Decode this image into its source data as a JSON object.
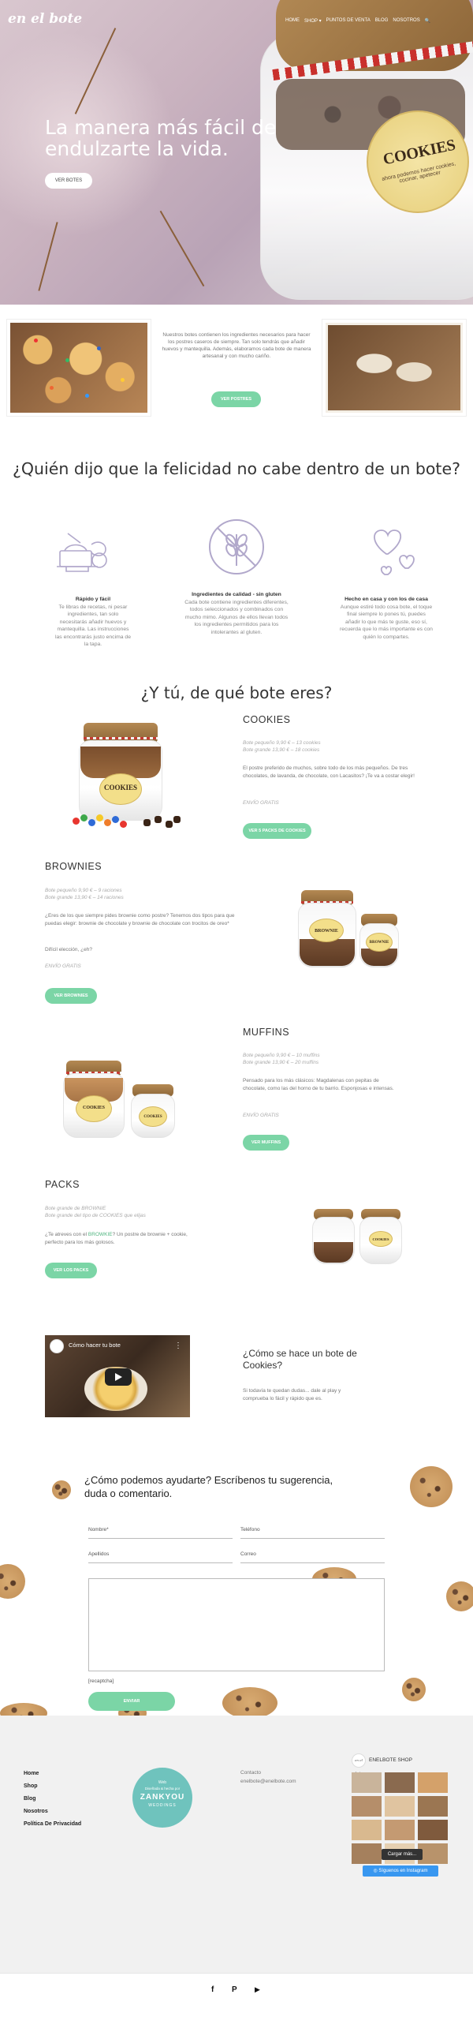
{
  "header": {
    "logo": "en el bote",
    "nav": [
      "HOME",
      "SHOP ▾",
      "PUNTOS DE VENTA",
      "BLOG",
      "NOSOTROS",
      "🔍"
    ]
  },
  "hero": {
    "title": "La manera más fácil de endulzarte la vida.",
    "button": "VER BOTES",
    "jar_label": "COOKIES",
    "jar_sublabel": "ahora podemos hacer cookies, cocinar, apetecer"
  },
  "intro": {
    "text": "Nuestros botes contienen los ingredientes necesarios para hacer los postres caseros de siempre. Tan solo tendrás que añadir huevos y mantequilla. Además, elaboramos cada bote de manera artesanal y con mucho cariño.",
    "button": "VER POSTRES"
  },
  "headline": "¿Quién dijo que la felicidad no cabe dentro de un bote?",
  "features": [
    {
      "title": "Rápido y fácil",
      "text": "Te libras de recetas, ni pesar ingredientes, tan solo necesitarás añadir huevos y mantequilla. Las instrucciones las encontrarás justo encima de la tapa."
    },
    {
      "title": "Ingredientes de calidad - sin gluten",
      "text": "Cada bote contiene ingredientes diferentes, todos seleccionados y combinados con mucho mimo. Algunos de ellos llevan todos los ingredientes permitidos para los intolerantes al gluten."
    },
    {
      "title": "Hecho en casa y con los de casa",
      "text": "Aunque estiré todo cosa bote, el toque final siempre lo pones tú, puedes añadir lo que más te guste, eso sí, recuerda que lo más importante es con quién lo compartes."
    }
  ],
  "products_title": "¿Y tú, de qué bote eres?",
  "products": {
    "cookies": {
      "title": "COOKIES",
      "price_small": "Bote pequeño 9,90 € – 13 cookies",
      "price_big": "Bote grande 13,90 € – 18 cookies",
      "desc": "El postre preferido de muchos, sobre todo de los más pequeños. De tres chocolates, de lavanda, de chocolate, con Lacasitos? ¡Te va a costar elegir!",
      "shipping": "ENVÍO GRATIS",
      "button": "VER 5 PACKS DE COOKIES",
      "label": "COOKIES"
    },
    "brownies": {
      "title": "BROWNIES",
      "price_small": "Bote pequeño 9,90 € – 9 raciones",
      "price_big": "Bote grande 13,90 € – 14 raciones",
      "desc": "¿Eres de los que siempre pides brownie como postre? Tenemos dos tipos para que puedas elegir: brownie de chocolate y brownie de chocolate con trocitos de oreo*",
      "desc2": "Difícil elección, ¿eh?",
      "shipping": "ENVÍO GRATIS",
      "button": "VER BROWNIES",
      "label": "BROWNIE"
    },
    "muffins": {
      "title": "MUFFINS",
      "price_small": "Bote pequeño 9,90 € – 10 muffins",
      "price_big": "Bote grande 13,90 € – 20 muffins",
      "desc": "Pensado para los más clásicos: Magdalenas con pepitas de chocolate, como las del horno de tu barrio. Esponjosas e intensas.",
      "shipping": "ENVÍO GRATIS",
      "button": "VER MUFFINS",
      "label": "COOKIES"
    },
    "packs": {
      "title": "PACKS",
      "price_big": "Bote grande de BROWNIE",
      "price_small": "Bote grande del tipo de COOKIES que elijas",
      "desc_before": "¿Te atreves con el ",
      "desc_link": "BROWKIE",
      "desc_after": "? Un postre de brownie + cookie, perfecto para los más golosos.",
      "button": "VER LOS PACKS",
      "label": "COOKIES"
    }
  },
  "video": {
    "title": "Cómo hacer tu bote",
    "heading": "¿Cómo se hace un bote de Cookies?",
    "text": "Si todavía te quedan dudas... dale al play y comprueba lo fácil y rápido que es.",
    "more": "⋮"
  },
  "contact": {
    "heading": "¿Cómo podemos ayudarte? Escríbenos tu sugerencia, duda o comentario.",
    "fields": {
      "name": "Nombre*",
      "phone": "Teléfono",
      "surname": "Apellidos",
      "email": "Correo"
    },
    "recaptcha": "[recaptcha]",
    "button": "ENVIAR"
  },
  "footer": {
    "nav": [
      "Home",
      "Shop",
      "Blog",
      "Nosotros",
      "Política De Privacidad"
    ],
    "badge_top": "Web",
    "badge_mid": "Diseñada & hecha por",
    "badge_brand": "ZANKYOU",
    "badge_bottom": "WEDDINGS",
    "contact_title": "Contacto",
    "contact_email": "enelbote@enelbote.com",
    "shop_logo": "en el bote",
    "shop_title": "ENELBOTE SHOP",
    "load_more": "Cargar más...",
    "follow": "Síguenos en Instagram",
    "social": [
      "f",
      "P",
      "▶"
    ]
  },
  "colors": {
    "accent": "#7bd5a6",
    "icon": "#b1a8cb",
    "instagram": "#3897f0",
    "badge": "#6fc3bd"
  }
}
